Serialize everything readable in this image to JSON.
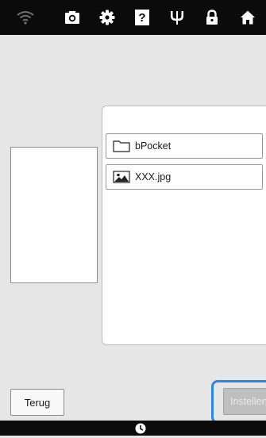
{
  "toolbar": {
    "icons": [
      "wifi-icon",
      "camera-icon",
      "gear-icon",
      "help-icon",
      "needle-icon",
      "lock-icon",
      "home-icon"
    ],
    "help_glyph": "?"
  },
  "files": [
    {
      "label": "bPocket",
      "icon": "folder-icon"
    },
    {
      "label": "XXX.jpg",
      "icon": "image-icon"
    }
  ],
  "buttons": {
    "back_label": "Terug",
    "set_label": "Instellen"
  },
  "bottombar": {
    "icon": "clock-icon"
  },
  "colors": {
    "bar_bg": "#0b0b0b",
    "accent": "#2f86e0",
    "disabled_bg": "#bfbfbf"
  }
}
